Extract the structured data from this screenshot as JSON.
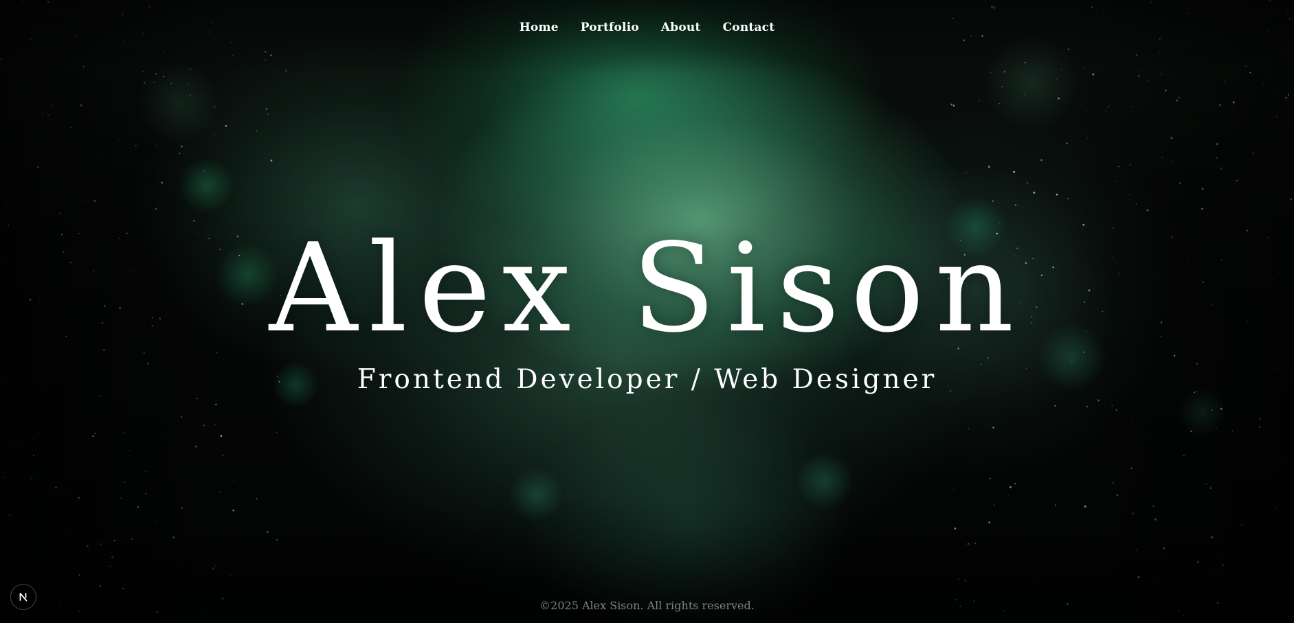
{
  "nav": {
    "items": [
      {
        "label": "Home"
      },
      {
        "label": "Portfolio"
      },
      {
        "label": "About"
      },
      {
        "label": "Contact"
      }
    ]
  },
  "hero": {
    "title": "Alex Sison",
    "subtitle": "Frontend Developer / Web Designer"
  },
  "footer": {
    "copyright": "©2025 Alex Sison. All rights reserved."
  },
  "badge": {
    "icon": "nextjs-logo-icon"
  },
  "colors": {
    "accent": "#3ecf94",
    "background": "#030504",
    "text": "#ffffff",
    "footer_text": "#a7b3ad"
  }
}
